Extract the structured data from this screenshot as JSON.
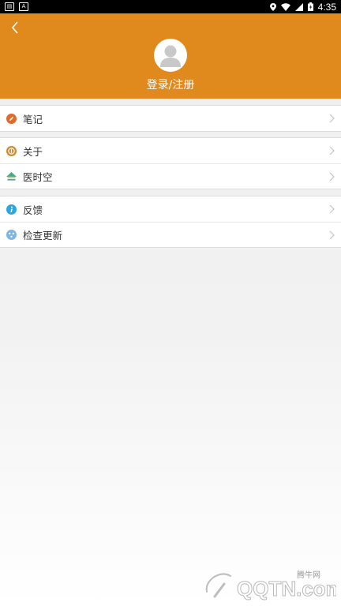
{
  "status_bar": {
    "left_icons": [
      "sim-icon",
      "a-icon"
    ],
    "right_icons": [
      "location-icon",
      "wifi-icon",
      "signal-icon",
      "battery-icon"
    ],
    "time": "4:35"
  },
  "header": {
    "back_icon": "chevron-left-icon",
    "avatar_icon": "avatar-icon",
    "login_label": "登录/注册",
    "color": "#e08a1e"
  },
  "menu": {
    "group1": [
      {
        "label": "笔记",
        "icon": "note-icon",
        "color": "#e06a2a"
      }
    ],
    "group2": [
      {
        "label": "关于",
        "icon": "about-icon",
        "color": "#d08a2a"
      },
      {
        "label": "医时空",
        "icon": "medical-space-icon",
        "color": "#4aaa8a"
      }
    ],
    "group3": [
      {
        "label": "反馈",
        "icon": "feedback-icon",
        "color": "#2aa6e0"
      },
      {
        "label": "检查更新",
        "icon": "update-icon",
        "color": "#7ab6e8"
      }
    ]
  },
  "watermark": {
    "site": "QQTN.com",
    "name": "腾牛网"
  }
}
